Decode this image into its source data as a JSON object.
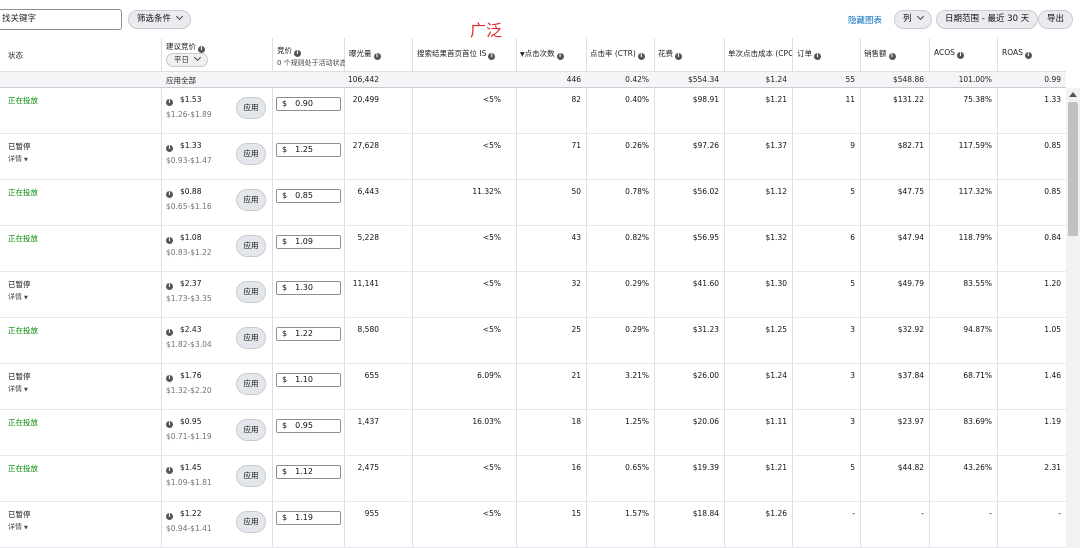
{
  "toolbar": {
    "search_value": "找关键字",
    "filter_label": "筛选条件",
    "hide_chart": "隐藏图表",
    "columns_label": "列",
    "date_range": "日期范围 - 最近 30 天",
    "export_label": "导出"
  },
  "annotation": "广泛",
  "headers": {
    "status": "状态",
    "suggested_bid": "建议竞价",
    "weekday": "平日",
    "bid": "竞价",
    "bid_note": "0 个规则处于活动状态",
    "impressions": "曝光量",
    "top_is": "搜索结果首页首位 IS",
    "clicks": "点击次数",
    "ctr": "点击率 (CTR)",
    "spend": "花费",
    "cpc": "单次点击成本 (CPC)",
    "orders": "订单",
    "sales": "销售额",
    "acos": "ACOS",
    "roas": "ROAS"
  },
  "summary": {
    "apply_all": "应用全部",
    "impressions": "106,442",
    "clicks": "446",
    "ctr": "0.42%",
    "spend": "$554.34",
    "cpc": "$1.24",
    "orders": "55",
    "sales": "$548.86",
    "acos": "101.00%",
    "roas": "0.99"
  },
  "apply_label": "应用",
  "details_label": "详情",
  "currency_symbol": "$",
  "rows": [
    {
      "status": "正在投放",
      "active": true,
      "suggested": "$1.53",
      "range": "$1.26-$1.89",
      "bid": "0.90",
      "impressions": "20,499",
      "top_is": "<5%",
      "clicks": "82",
      "ctr": "0.40%",
      "spend": "$98.91",
      "cpc": "$1.21",
      "orders": "11",
      "sales": "$131.22",
      "acos": "75.38%",
      "roas": "1.33"
    },
    {
      "status": "已暂停",
      "active": false,
      "suggested": "$1.33",
      "range": "$0.93-$1.47",
      "bid": "1.25",
      "impressions": "27,628",
      "top_is": "<5%",
      "clicks": "71",
      "ctr": "0.26%",
      "spend": "$97.26",
      "cpc": "$1.37",
      "orders": "9",
      "sales": "$82.71",
      "acos": "117.59%",
      "roas": "0.85"
    },
    {
      "status": "正在投放",
      "active": true,
      "suggested": "$0.88",
      "range": "$0.65-$1.16",
      "bid": "0.85",
      "impressions": "6,443",
      "top_is": "11.32%",
      "clicks": "50",
      "ctr": "0.78%",
      "spend": "$56.02",
      "cpc": "$1.12",
      "orders": "5",
      "sales": "$47.75",
      "acos": "117.32%",
      "roas": "0.85"
    },
    {
      "status": "正在投放",
      "active": true,
      "suggested": "$1.08",
      "range": "$0.83-$1.22",
      "bid": "1.09",
      "impressions": "5,228",
      "top_is": "<5%",
      "clicks": "43",
      "ctr": "0.82%",
      "spend": "$56.95",
      "cpc": "$1.32",
      "orders": "6",
      "sales": "$47.94",
      "acos": "118.79%",
      "roas": "0.84"
    },
    {
      "status": "已暂停",
      "active": false,
      "suggested": "$2.37",
      "range": "$1.73-$3.35",
      "bid": "1.30",
      "impressions": "11,141",
      "top_is": "<5%",
      "clicks": "32",
      "ctr": "0.29%",
      "spend": "$41.60",
      "cpc": "$1.30",
      "orders": "5",
      "sales": "$49.79",
      "acos": "83.55%",
      "roas": "1.20"
    },
    {
      "status": "正在投放",
      "active": true,
      "suggested": "$2.43",
      "range": "$1.82-$3.04",
      "bid": "1.22",
      "impressions": "8,580",
      "top_is": "<5%",
      "clicks": "25",
      "ctr": "0.29%",
      "spend": "$31.23",
      "cpc": "$1.25",
      "orders": "3",
      "sales": "$32.92",
      "acos": "94.87%",
      "roas": "1.05"
    },
    {
      "status": "已暂停",
      "active": false,
      "suggested": "$1.76",
      "range": "$1.32-$2.20",
      "bid": "1.10",
      "impressions": "655",
      "top_is": "6.09%",
      "clicks": "21",
      "ctr": "3.21%",
      "spend": "$26.00",
      "cpc": "$1.24",
      "orders": "3",
      "sales": "$37.84",
      "acos": "68.71%",
      "roas": "1.46"
    },
    {
      "status": "正在投放",
      "active": true,
      "suggested": "$0.95",
      "range": "$0.71-$1.19",
      "bid": "0.95",
      "impressions": "1,437",
      "top_is": "16.03%",
      "clicks": "18",
      "ctr": "1.25%",
      "spend": "$20.06",
      "cpc": "$1.11",
      "orders": "3",
      "sales": "$23.97",
      "acos": "83.69%",
      "roas": "1.19"
    },
    {
      "status": "正在投放",
      "active": true,
      "suggested": "$1.45",
      "range": "$1.09-$1.81",
      "bid": "1.12",
      "impressions": "2,475",
      "top_is": "<5%",
      "clicks": "16",
      "ctr": "0.65%",
      "spend": "$19.39",
      "cpc": "$1.21",
      "orders": "5",
      "sales": "$44.82",
      "acos": "43.26%",
      "roas": "2.31"
    },
    {
      "status": "已暂停",
      "active": false,
      "suggested": "$1.22",
      "range": "$0.94-$1.41",
      "bid": "1.19",
      "impressions": "955",
      "top_is": "<5%",
      "clicks": "15",
      "ctr": "1.57%",
      "spend": "$18.84",
      "cpc": "$1.26",
      "orders": "-",
      "sales": "-",
      "acos": "-",
      "roas": "-"
    }
  ],
  "colors": {
    "active_status": "#078a07",
    "link": "#0b6bbd",
    "annotation": "#e12b2b",
    "grid": "#dde0e3"
  }
}
